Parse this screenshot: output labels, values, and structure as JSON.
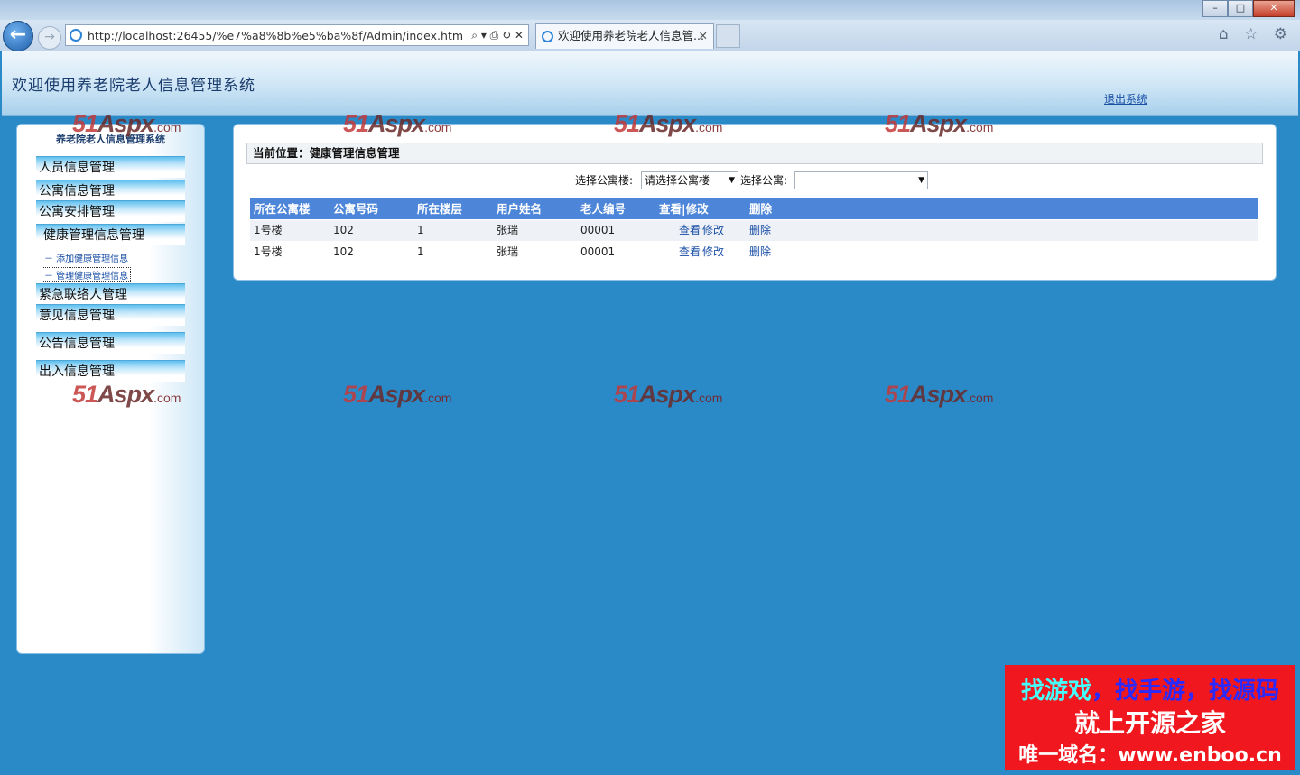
{
  "browser": {
    "address": "http://localhost:26455/%e7%a8%8b%e5%ba%8f/Admin/index.htm",
    "address_tools": "⌕ ▾ ⎙ ↻ ✕",
    "tab_title": "欢迎使用养老院老人信息管...",
    "tab_close": "✕",
    "window_buttons": {
      "minimize": "–",
      "maximize": "□",
      "close": "✕"
    },
    "right_icons": "⌂ ☆ ⚙",
    "icons": [
      "back-icon",
      "forward-icon",
      "search-icon",
      "refresh-icon",
      "stop-icon",
      "home-icon",
      "favorites-icon",
      "settings-icon"
    ]
  },
  "header": {
    "title": "欢迎使用养老院老人信息管理系统",
    "logout": "退出系统"
  },
  "sidebar": {
    "title": "养老院老人信息管理系统",
    "menu": [
      {
        "label": "人员信息管理"
      },
      {
        "label": "公寓信息管理"
      },
      {
        "label": "公寓安排管理"
      },
      {
        "label": "健康管理信息管理"
      },
      {
        "label": "紧急联络人管理"
      },
      {
        "label": "意见信息管理"
      },
      {
        "label": "公告信息管理"
      },
      {
        "label": "出入信息管理"
      }
    ],
    "submenu": [
      {
        "label": "－ 添加健康管理信息"
      },
      {
        "label": "－ 管理健康管理信息"
      }
    ]
  },
  "main": {
    "breadcrumb": "当前位置：健康管理信息管理",
    "filter": {
      "building_label": "选择公寓楼:",
      "building_value": "请选择公寓楼",
      "apartment_label": "选择公寓:",
      "apartment_value": ""
    },
    "table": {
      "headers": [
        "所在公寓楼",
        "公寓号码",
        "所在楼层",
        "用户姓名",
        "老人编号",
        "查看|修改",
        "删除"
      ],
      "rows": [
        {
          "building": "1号楼",
          "room": "102",
          "floor": "1",
          "name": "张瑞",
          "code": "00001",
          "view": "查看",
          "edit": "修改",
          "delete": "删除"
        },
        {
          "building": "1号楼",
          "room": "102",
          "floor": "1",
          "name": "张瑞",
          "code": "00001",
          "view": "查看",
          "edit": "修改",
          "delete": "删除"
        }
      ]
    }
  },
  "watermark": {
    "a": "51",
    "b": "Aspx",
    "c": ".com"
  },
  "ad": {
    "line1_a": "找游戏",
    "line1_b": "，找手游，找源码",
    "line2": "就上开源之家",
    "line3": "唯一域名：www.enboo.cn"
  },
  "colors": {
    "page_bg": "#2a8ac8",
    "table_header": "#4d86d9",
    "link": "#1a4fa6",
    "ad_bg": "#f0181e"
  }
}
